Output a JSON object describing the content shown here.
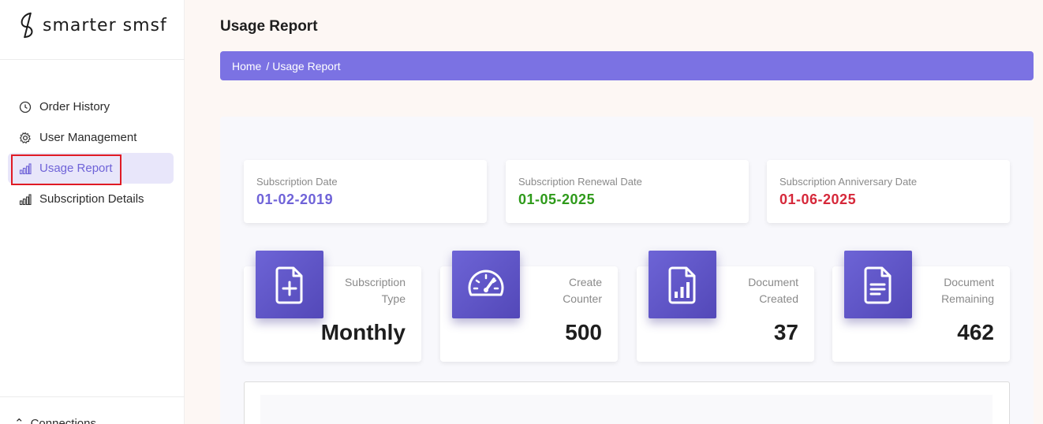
{
  "app": {
    "logo_text": "smarter smsf"
  },
  "sidebar": {
    "items": [
      {
        "label": "Order History",
        "icon": "clock-icon"
      },
      {
        "label": "User Management",
        "icon": "gear-icon"
      },
      {
        "label": "Usage Report",
        "icon": "bar-chart-icon",
        "active": true
      },
      {
        "label": "Subscription Details",
        "icon": "bar-chart-icon"
      }
    ],
    "bottom_item": "Connections"
  },
  "page": {
    "title": "Usage Report",
    "breadcrumb": {
      "home": "Home",
      "separator": "/",
      "current": "Usage Report"
    }
  },
  "dates": [
    {
      "label": "Subscription Date",
      "value": "01-02-2019",
      "color": "#6f63d8"
    },
    {
      "label": "Subscription Renewal Date",
      "value": "01-05-2025",
      "color": "#2e9a1a"
    },
    {
      "label": "Subscription Anniversary Date",
      "value": "01-06-2025",
      "color": "#d6283a"
    }
  ],
  "stats": [
    {
      "label_line1": "Subscription",
      "label_line2": "Type",
      "value": "Monthly",
      "icon": "file-plus-icon"
    },
    {
      "label_line1": "Create",
      "label_line2": "Counter",
      "value": "500",
      "icon": "speedometer-icon"
    },
    {
      "label_line1": "Document",
      "label_line2": "Created",
      "value": "37",
      "icon": "file-chart-icon"
    },
    {
      "label_line1": "Document",
      "label_line2": "Remaining",
      "value": "462",
      "icon": "file-text-icon"
    }
  ],
  "colors": {
    "accent": "#7b72e3",
    "icon_bg": "#5f55c9",
    "active_bg": "#e8e6fa",
    "highlight_border": "#e01b24"
  }
}
